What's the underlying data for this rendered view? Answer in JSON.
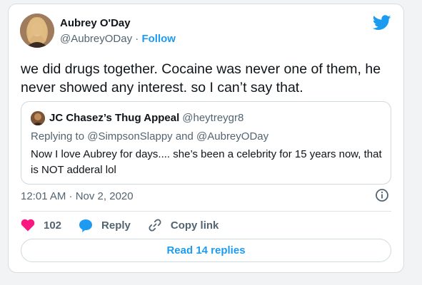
{
  "tweet": {
    "author_name": "Aubrey O'Day",
    "author_handle": "@AubreyODay",
    "separator": " · ",
    "follow_label": "Follow",
    "text": "we did drugs together. Cocaine was never one of them, he never showed any interest. so I can’t say that.",
    "timestamp": "12:01 AM · Nov 2, 2020",
    "like_count": "102",
    "reply_label": "Reply",
    "copy_link_label": "Copy link",
    "read_replies_label": "Read 14 replies"
  },
  "quoted_tweet": {
    "author_name": "JC Chasez’s Thug Appeal",
    "author_handle": "@heytreygr8",
    "replying_to": "Replying to @SimpsonSlappy and @AubreyODay",
    "text": "Now I love Aubrey for days.... she’s been a celebrity for 15 years now, that is NOT adderal lol"
  },
  "icons": {
    "brand": "twitter-bird-icon",
    "info": "info-icon",
    "like": "heart-icon",
    "reply": "speech-bubble-icon",
    "copy_link": "link-icon"
  },
  "colors": {
    "accent": "#1d9bf0",
    "like": "#f91880",
    "text": "#0f1419",
    "secondary_text": "#536471",
    "border": "#cfd9de"
  }
}
